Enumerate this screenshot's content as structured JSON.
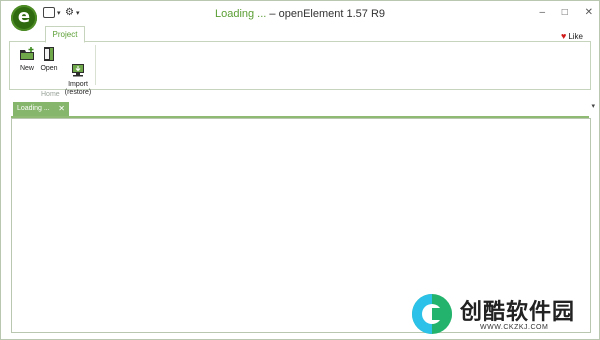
{
  "titlebar": {
    "status": "Loading ...",
    "app_title": "openElement 1.57 R9",
    "minimize": "–",
    "maximize": "□",
    "close": "✕"
  },
  "quick_access": {
    "dropdown_glyph": "▾"
  },
  "ribbon": {
    "tab": "Project",
    "like": "Like",
    "group_label": "Home",
    "buttons": [
      {
        "label": "New",
        "icon": "new-folder-icon"
      },
      {
        "label": "Open",
        "icon": "open-book-icon"
      },
      {
        "label": "Import\n(restore)",
        "icon": "import-computer-icon"
      }
    ]
  },
  "documents": {
    "tab_label": "Loading ...",
    "tab_close": "✕",
    "overflow_glyph": "▾"
  },
  "watermark": {
    "text": "创酷软件园",
    "url": "WWW.CKZKJ.COM"
  },
  "colors": {
    "accent": "#5a9e33",
    "tab_active": "#86b66b",
    "logo": "#2f6a10",
    "like_heart": "#d01a1a"
  }
}
